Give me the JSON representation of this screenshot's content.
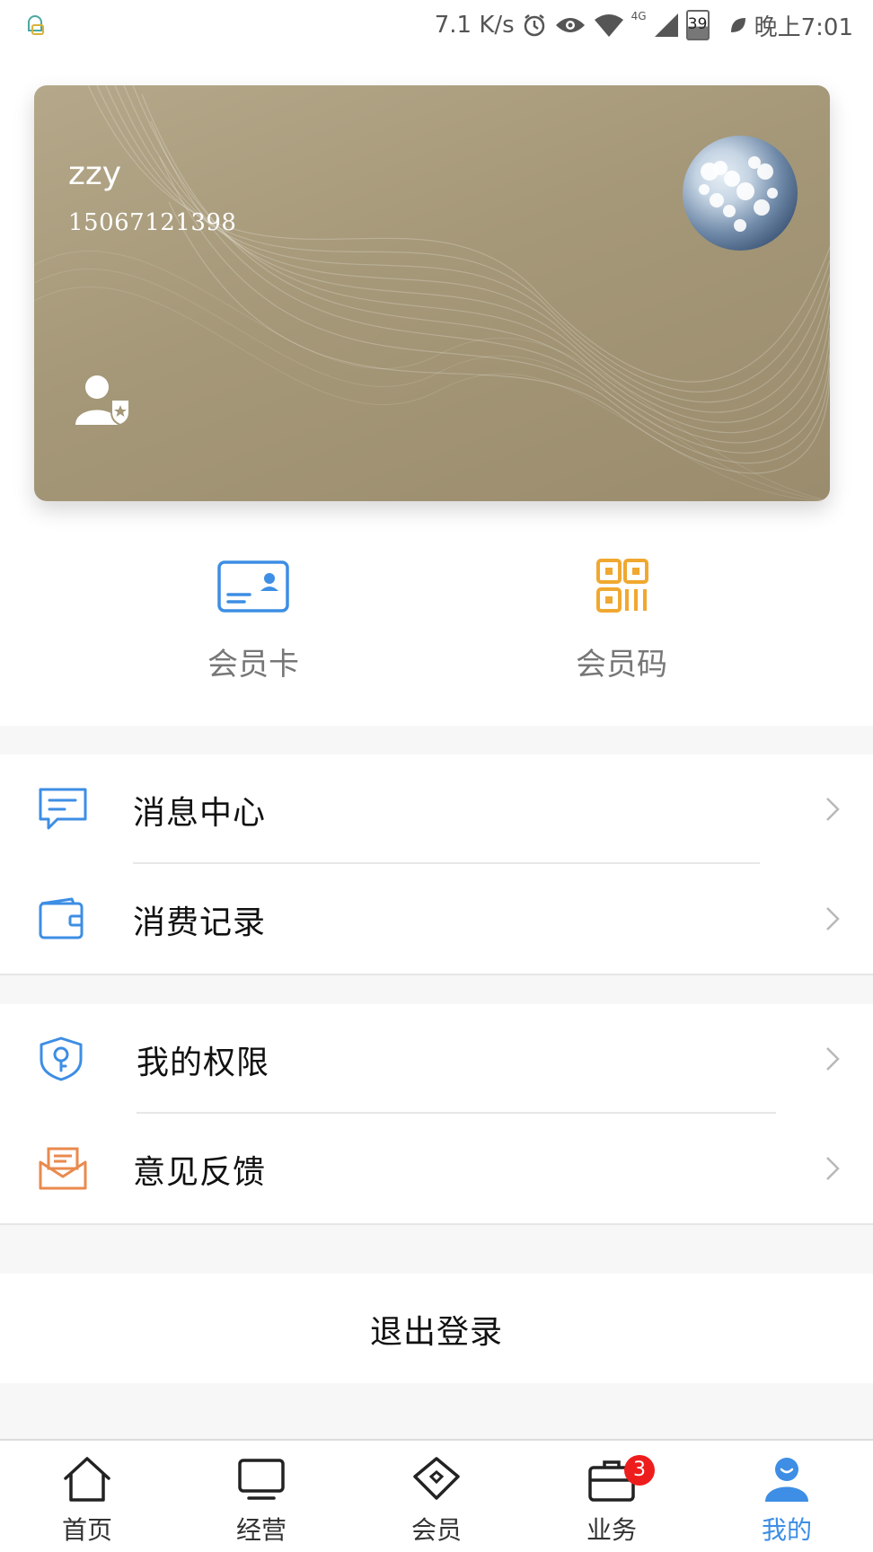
{
  "status_bar": {
    "network_speed": "7.1 K/s",
    "network_type": "4G",
    "battery": "39",
    "time": "晚上7:01"
  },
  "card": {
    "name": "zzy",
    "phone": "15067121398"
  },
  "quick_actions": [
    {
      "label": "会员卡",
      "icon": "member-card-icon"
    },
    {
      "label": "会员码",
      "icon": "qr-code-icon"
    }
  ],
  "menu": {
    "group1": [
      {
        "label": "消息中心",
        "icon": "message-icon"
      },
      {
        "label": "消费记录",
        "icon": "wallet-icon"
      }
    ],
    "group2": [
      {
        "label": "我的权限",
        "icon": "shield-key-icon"
      },
      {
        "label": "意见反馈",
        "icon": "feedback-mail-icon"
      }
    ]
  },
  "logout_label": "退出登录",
  "tabs": [
    {
      "label": "首页",
      "icon": "home-icon"
    },
    {
      "label": "经营",
      "icon": "monitor-icon"
    },
    {
      "label": "会员",
      "icon": "diamond-icon"
    },
    {
      "label": "业务",
      "icon": "briefcase-icon",
      "badge": "3"
    },
    {
      "label": "我的",
      "icon": "person-icon",
      "active": true
    }
  ],
  "colors": {
    "accent": "#3d8ee4",
    "card_gold": "#a59878",
    "qr_orange": "#f0a830",
    "feedback_orange": "#e98a4e",
    "badge_red": "#ee1d1d"
  }
}
